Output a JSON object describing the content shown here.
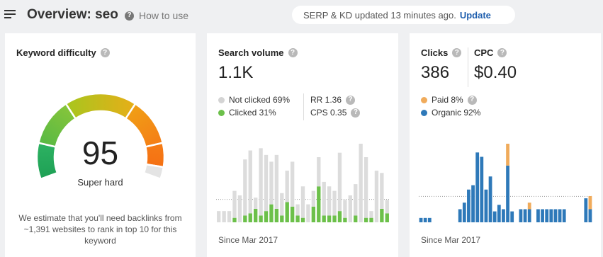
{
  "header": {
    "title": "Overview: seo",
    "how_to": "How to use",
    "status_text": "SERP & KD updated 13 minutes ago.",
    "update_label": "Update"
  },
  "kd": {
    "title": "Keyword difficulty",
    "value": "95",
    "label": "Super hard",
    "level": 0.95,
    "note": "We estimate that you'll need backlinks from ~1,391 websites to rank in top 10 for this keyword"
  },
  "volume": {
    "title": "Search volume",
    "value": "1.1K",
    "not_clicked": "Not clicked 69%",
    "clicked": "Clicked 31%",
    "rr": "RR 1.36",
    "cps": "CPS 0.35",
    "since": "Since Mar 2017"
  },
  "clicks": {
    "title": "Clicks",
    "value": "386",
    "cpc_title": "CPC",
    "cpc_value": "$0.40",
    "paid": "Paid 8%",
    "organic": "Organic 92%",
    "since": "Since Mar 2017"
  },
  "colors": {
    "not_clicked": "#dcdcdc",
    "clicked": "#6cc04a",
    "paid": "#f0ab5b",
    "organic": "#2e79b9",
    "link": "#1f5fae"
  },
  "chart_data": [
    {
      "type": "bar",
      "name": "search-volume",
      "stacked": true,
      "series": [
        {
          "name": "Clicked",
          "values": [
            0,
            0,
            0,
            2,
            0,
            3,
            4,
            6,
            3,
            5,
            8,
            6,
            3,
            9,
            7,
            3,
            2,
            0,
            7,
            16,
            3,
            3,
            3,
            5,
            2,
            0,
            3,
            0,
            2,
            2,
            0,
            6,
            4
          ]
        },
        {
          "name": "Not clicked",
          "values": [
            5,
            5,
            5,
            12,
            12,
            25,
            28,
            5,
            30,
            25,
            19,
            24,
            10,
            14,
            20,
            5,
            14,
            8,
            7,
            13,
            15,
            13,
            11,
            26,
            8,
            12,
            14,
            35,
            27,
            3,
            23,
            16,
            6
          ]
        }
      ]
    },
    {
      "type": "bar",
      "name": "clicks",
      "stacked": true,
      "series": [
        {
          "name": "Organic",
          "values": [
            2,
            2,
            2,
            0,
            0,
            0,
            0,
            0,
            0,
            6,
            9,
            15,
            17,
            32,
            30,
            15,
            21,
            5,
            8,
            6,
            26,
            5,
            0,
            6,
            6,
            6,
            0,
            6,
            6,
            6,
            6,
            6,
            6,
            6,
            0,
            0,
            0,
            0,
            11,
            6
          ]
        },
        {
          "name": "Paid",
          "values": [
            0,
            0,
            0,
            0,
            0,
            0,
            0,
            0,
            0,
            0,
            0,
            0,
            0,
            0,
            0,
            0,
            0,
            0,
            0,
            0,
            10,
            0,
            0,
            0,
            0,
            3,
            0,
            0,
            0,
            0,
            0,
            0,
            0,
            0,
            0,
            0,
            0,
            0,
            0,
            6
          ]
        }
      ]
    }
  ]
}
